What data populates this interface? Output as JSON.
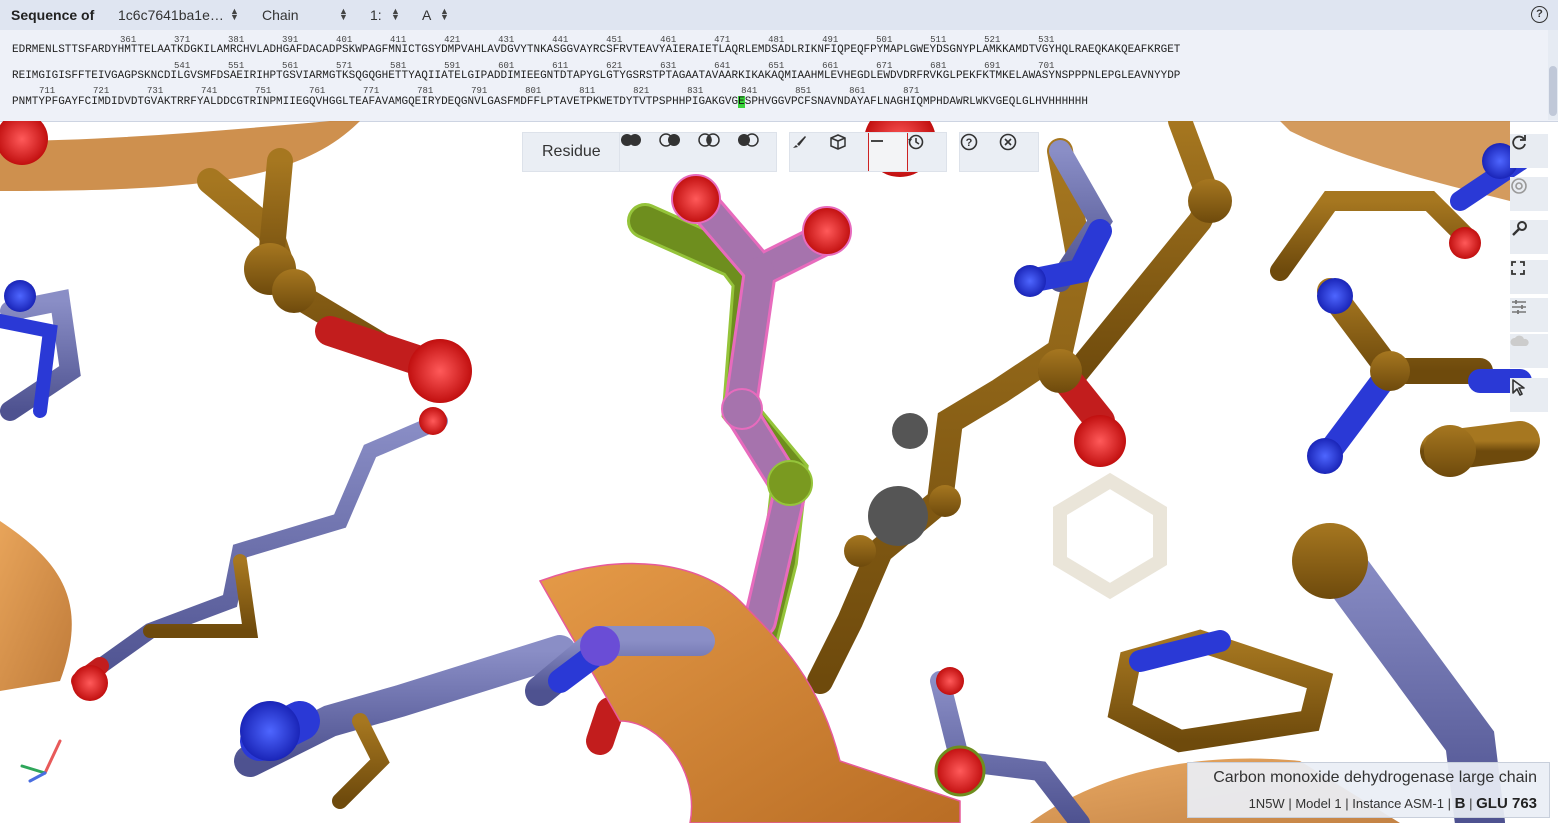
{
  "header": {
    "label": "Sequence of",
    "entry": "1c6c7641ba1e…",
    "mode": "Chain",
    "model": "1:",
    "chain": "A",
    "help_icon": "help-icon"
  },
  "sequence": {
    "row1_numbers": "                    361       371       381       391       401       411       421       431       441       451       461       471       481       491       501       511       521       531",
    "row1": "EDRMENLSTTSFARDYHMTTELAATKDGKILAMRCHVLADHGAFDACADPSKWPAGFMNICTGSYDMPVAHLAVDGVYTNKASGGVAYRCSFRVTEAVYAIERAIETLAQRLEMDSADLRIKNFIQPEQFPYMAPLGWEYDSGNYPLAMKKAMDTVGYHQLRAEQKAKQEAFKRGET",
    "row2_numbers": "                              541       551       561       571       581       591       601       611       621       631       641       651       661       671       681       691       701",
    "row2": "REIMGIGISFFTEIVGAGPSKNCDILGVSMFDSAEIRIHPTGSVIARMGTKSQGQGHETTYAQIIATELGIPADDIMIEEGNTDTAPYGLGTYGSRSTPTAGAATAVAARKIKAKAQMIAAHMLEVHEGDLEWDVDRFRVKGLPEKFKTMKELAWASYNSPPPNLEPGLEAVNYYDP",
    "row3_numbers": "     711       721       731       741       751       761       771       781       791       801       811       821       831       841       851       861       871",
    "row3_before": "PNMTYPFGAYFCIMDIDVDTGVAKTRRFYALDDCGTRINPMIIEGQVHGGLTEAFAVAMGQEIRYDEQGNVLGASFMDFFLPTAVETPKWETDYTVTPSPHHPIGAKGVG",
    "row3_highlight": "E",
    "row3_after": "SPHVGGVPCFSNAVNDAYAFLNAGHIQMPHDAWRLWKVGEQLGLHVHHHHHH"
  },
  "toolbar": {
    "residue_label": "Residue",
    "icons": [
      "select-all-icon",
      "select-union-icon",
      "select-intersect-icon",
      "select-subtract-icon",
      "brush-icon",
      "cube-icon",
      "minus-icon",
      "history-icon",
      "help-icon",
      "close-icon"
    ]
  },
  "right_toolbar": {
    "icons": [
      "reset-view-icon",
      "screenshot-icon",
      "wrench-icon",
      "fullscreen-icon",
      "settings-sliders-icon",
      "cloud-icon",
      "pointer-icon"
    ]
  },
  "info": {
    "molecule": "Carbon monoxide dehydrogenase large chain",
    "pdb": "1N5W",
    "model": "Model 1",
    "instance": "Instance ASM-1",
    "chain": "B",
    "residue": "GLU 763",
    "sep": "|"
  },
  "colors": {
    "carbon_blue": "#6b6fa8",
    "carbon_brown": "#8a5f14",
    "oxygen": "#e31c1c",
    "nitrogen": "#2838d8",
    "ribbon": "#d08838",
    "focus_purple": "#a673ad",
    "focus_green": "#6e8e1e"
  }
}
